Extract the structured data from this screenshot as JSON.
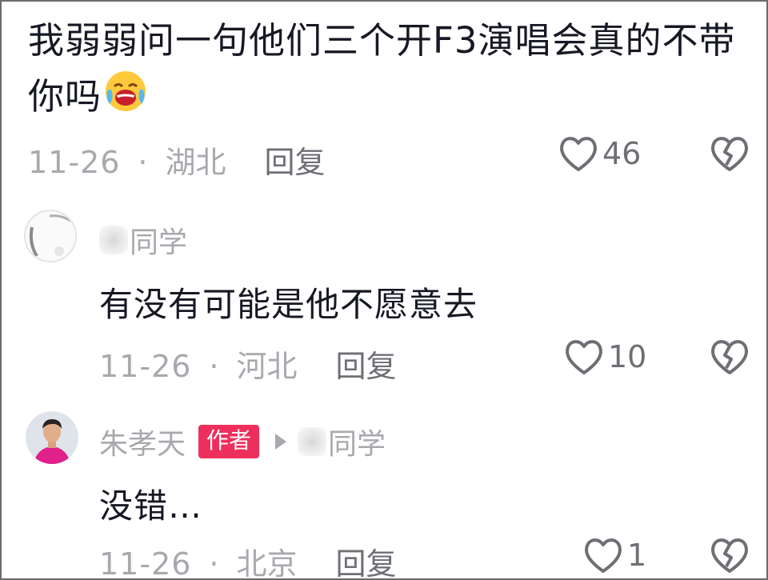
{
  "main_comment": {
    "text": "我弱弱问一句他们三个开F3演唱会真的不带你吗",
    "emoji": "laughing-crying-emoji",
    "date": "11-26",
    "separator": "·",
    "location": "湖北",
    "reply_label": "回复",
    "likes": "46"
  },
  "replies": [
    {
      "username": "同学",
      "text": "有没有可能是他不愿意去",
      "date": "11-26",
      "separator": "·",
      "location": "河北",
      "reply_label": "回复",
      "likes": "10"
    },
    {
      "username": "朱孝天",
      "badge": "作者",
      "reply_to": "同学",
      "text": "没错…",
      "date": "11-26",
      "separator": "·",
      "location": "北京",
      "reply_label": "回复",
      "likes": "1"
    }
  ],
  "colors": {
    "text": "#161823",
    "meta": "#a8a9ae",
    "action": "#6e6f75",
    "badge": "#ed2f5d"
  }
}
